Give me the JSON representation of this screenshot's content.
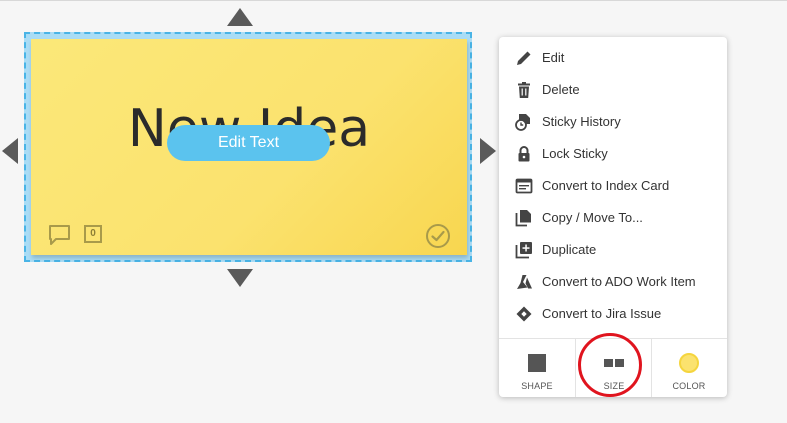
{
  "sticky": {
    "title": "New Idea",
    "edit_button_label": "Edit Text",
    "comment_count": "0",
    "color": "#fbe26e"
  },
  "menu": {
    "items": [
      {
        "label": "Edit",
        "icon": "pencil-icon"
      },
      {
        "label": "Delete",
        "icon": "trash-icon"
      },
      {
        "label": "Sticky History",
        "icon": "history-icon"
      },
      {
        "label": "Lock Sticky",
        "icon": "lock-icon"
      },
      {
        "label": "Convert to Index Card",
        "icon": "index-card-icon"
      },
      {
        "label": "Copy / Move To...",
        "icon": "copy-icon"
      },
      {
        "label": "Duplicate",
        "icon": "duplicate-icon"
      },
      {
        "label": "Convert to ADO Work Item",
        "icon": "azure-devops-icon"
      },
      {
        "label": "Convert to Jira Issue",
        "icon": "jira-icon"
      }
    ],
    "tools": [
      {
        "label": "SHAPE",
        "icon": "square-shape-icon"
      },
      {
        "label": "SIZE",
        "icon": "size-icon"
      },
      {
        "label": "COLOR",
        "icon": "color-swatch-icon"
      }
    ]
  },
  "colors": {
    "accent_blue": "#5bc3ee",
    "selection_border": "#49b4e6",
    "highlight_red": "#e0141e",
    "swatch_yellow": "#fbe26e"
  }
}
